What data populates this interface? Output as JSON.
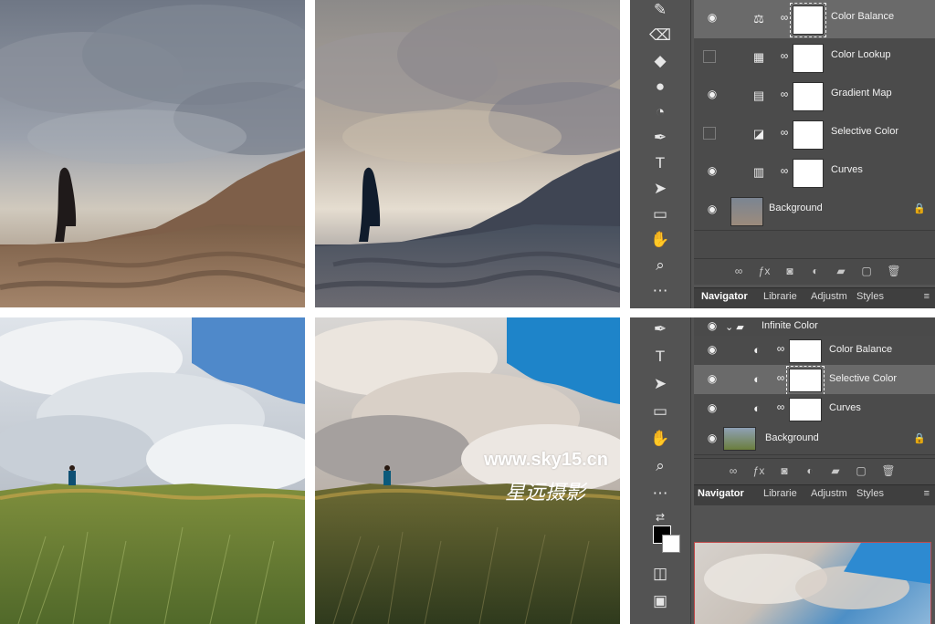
{
  "top_panel": {
    "layers": [
      {
        "name": "Color Balance",
        "icon": "balance-icon",
        "visible": true,
        "selected": true,
        "masked": true
      },
      {
        "name": "Color Lookup",
        "icon": "grid-icon",
        "visible": false,
        "selected": false,
        "masked": true
      },
      {
        "name": "Gradient Map",
        "icon": "gradient-icon",
        "visible": true,
        "selected": false,
        "masked": true
      },
      {
        "name": "Selective Color",
        "icon": "selective-color-icon",
        "visible": false,
        "selected": false,
        "masked": true
      },
      {
        "name": "Curves",
        "icon": "curves-icon",
        "visible": true,
        "selected": false,
        "masked": true
      },
      {
        "name": "Background",
        "icon": "image-thumb-icon",
        "visible": true,
        "selected": false,
        "masked": false
      }
    ],
    "tabs": [
      "Navigator",
      "Librarie",
      "Adjustm",
      "Styles"
    ]
  },
  "bottom_panel": {
    "group_name": "Infinite Color",
    "layers": [
      {
        "name": "Color Balance",
        "icon": "adjustment-icon",
        "visible": true,
        "selected": false
      },
      {
        "name": "Selective Color",
        "icon": "adjustment-icon",
        "visible": true,
        "selected": true
      },
      {
        "name": "Curves",
        "icon": "adjustment-icon",
        "visible": true,
        "selected": false
      },
      {
        "name": "Background",
        "icon": "image-thumb-icon",
        "visible": true,
        "selected": false
      }
    ],
    "tabs": [
      "Navigator",
      "Librarie",
      "Adjustm",
      "Styles"
    ]
  },
  "watermark": {
    "url": "www.sky15.cn",
    "chinese": "星远摄影"
  },
  "colors": {
    "panel": "#535353",
    "panel_dark": "#3f3f3f",
    "selection": "#6a6a6a"
  }
}
